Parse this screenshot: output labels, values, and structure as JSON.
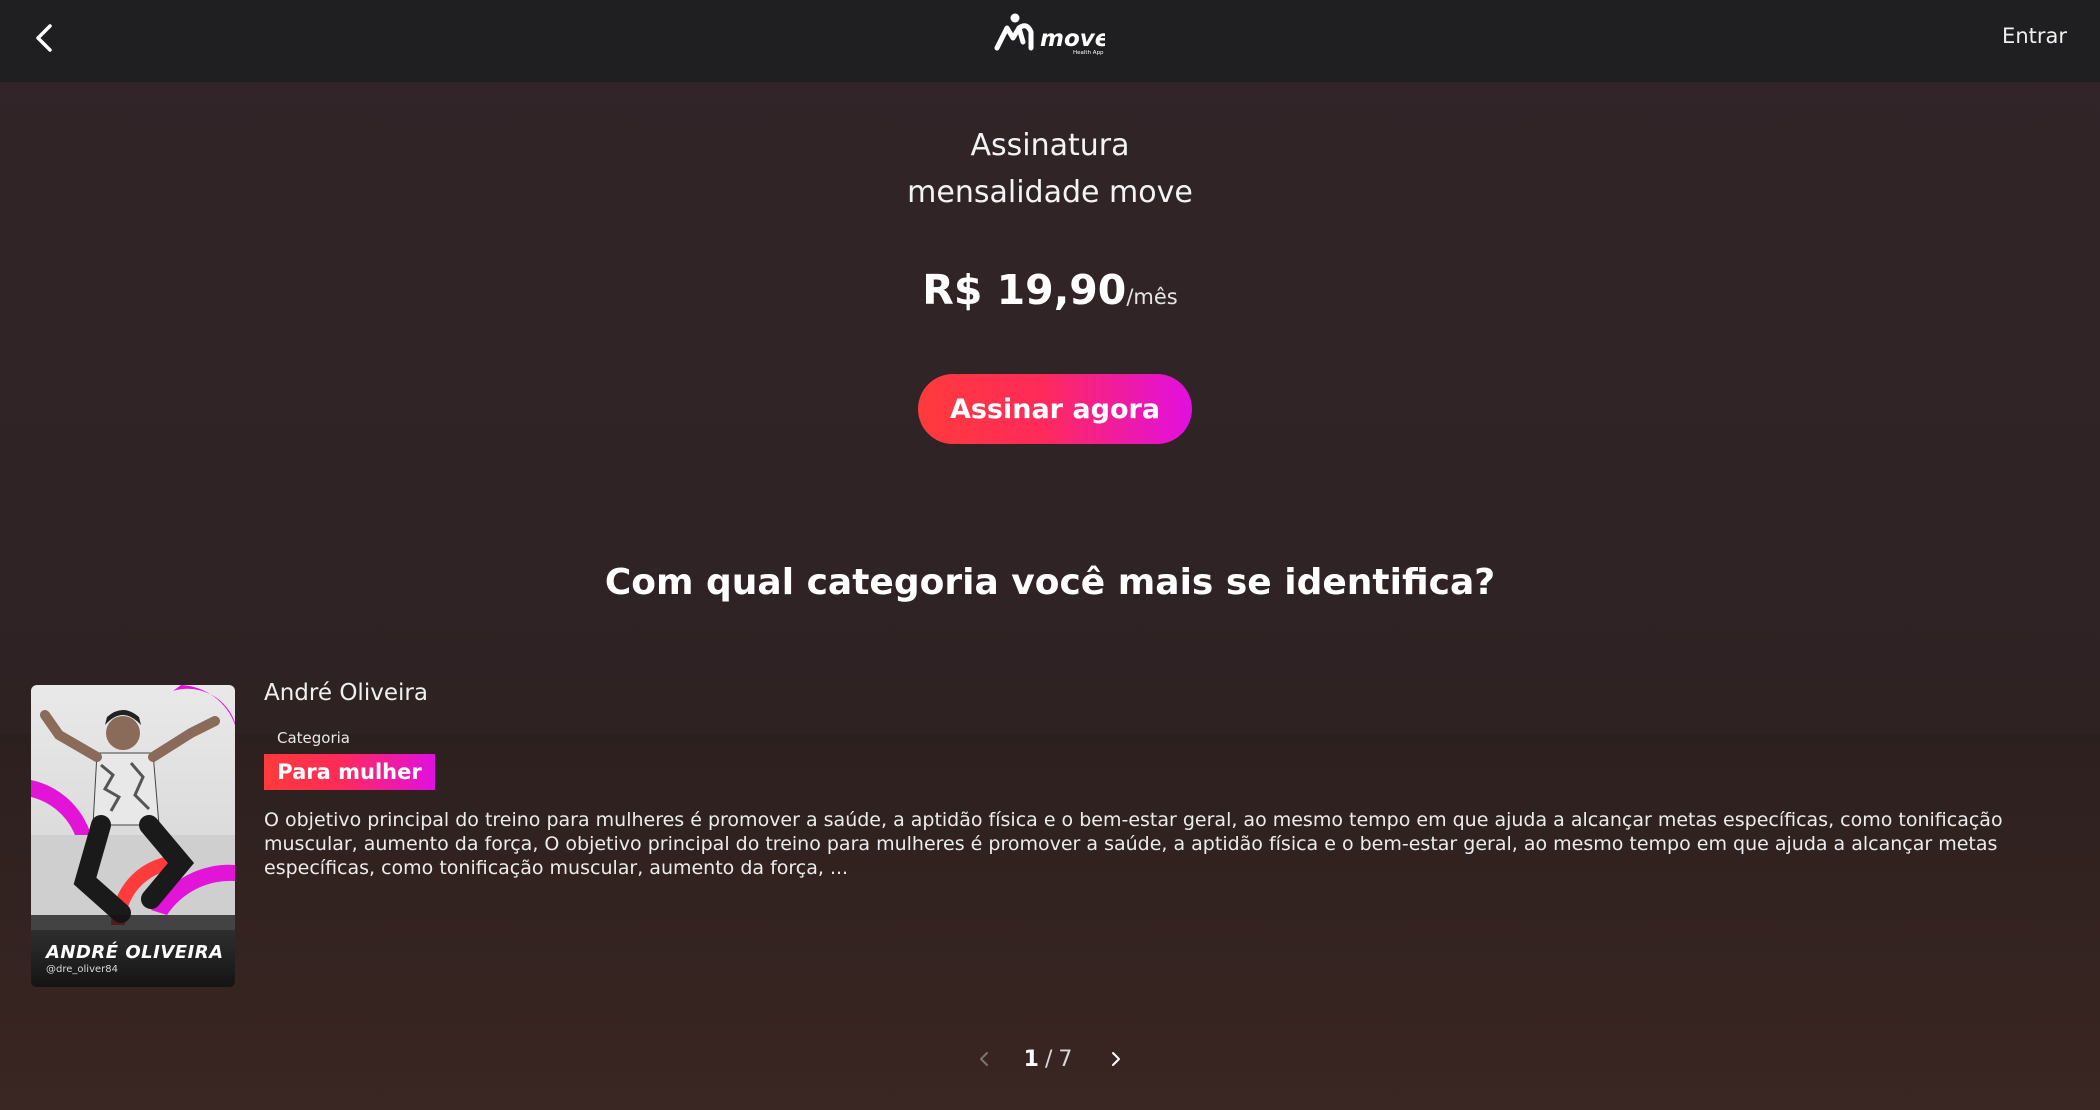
{
  "header": {
    "logo_text": "move",
    "logo_subtext": "Health App",
    "login_label": "Entrar"
  },
  "plan": {
    "title_line1": "Assinatura",
    "title_line2": "mensalidade move",
    "price": "R$ 19,90",
    "price_unit": "/mês",
    "cta_label": "Assinar agora"
  },
  "section": {
    "question": "Com qual categoria você mais se identifica?"
  },
  "trainer_card": {
    "name": "André Oliveira",
    "category_label": "Categoria",
    "category": "Para mulher",
    "description": "O objetivo principal do treino para mulheres é promover a saúde, a aptidão física e o bem-estar geral, ao mesmo tempo em que ajuda a alcançar metas específicas, como tonificação muscular, aumento da força, O objetivo principal do treino para mulheres é promover a saúde, a aptidão física e o bem-estar geral, ao mesmo tempo em que ajuda a alcançar metas específicas, como tonificação muscular, aumento da força, ...",
    "image_name": "ANDRÉ OLIVEIRA",
    "image_handle": "@dre_oliver84"
  },
  "pagination": {
    "current": "1",
    "separator": "/",
    "total": "7"
  },
  "colors": {
    "accent_start": "#ff3b3b",
    "accent_end": "#e10fe0",
    "navbar": "#1f1f21"
  },
  "icons": {
    "back": "chevron-left-icon",
    "prev": "chevron-left-icon",
    "next": "chevron-right-icon"
  }
}
